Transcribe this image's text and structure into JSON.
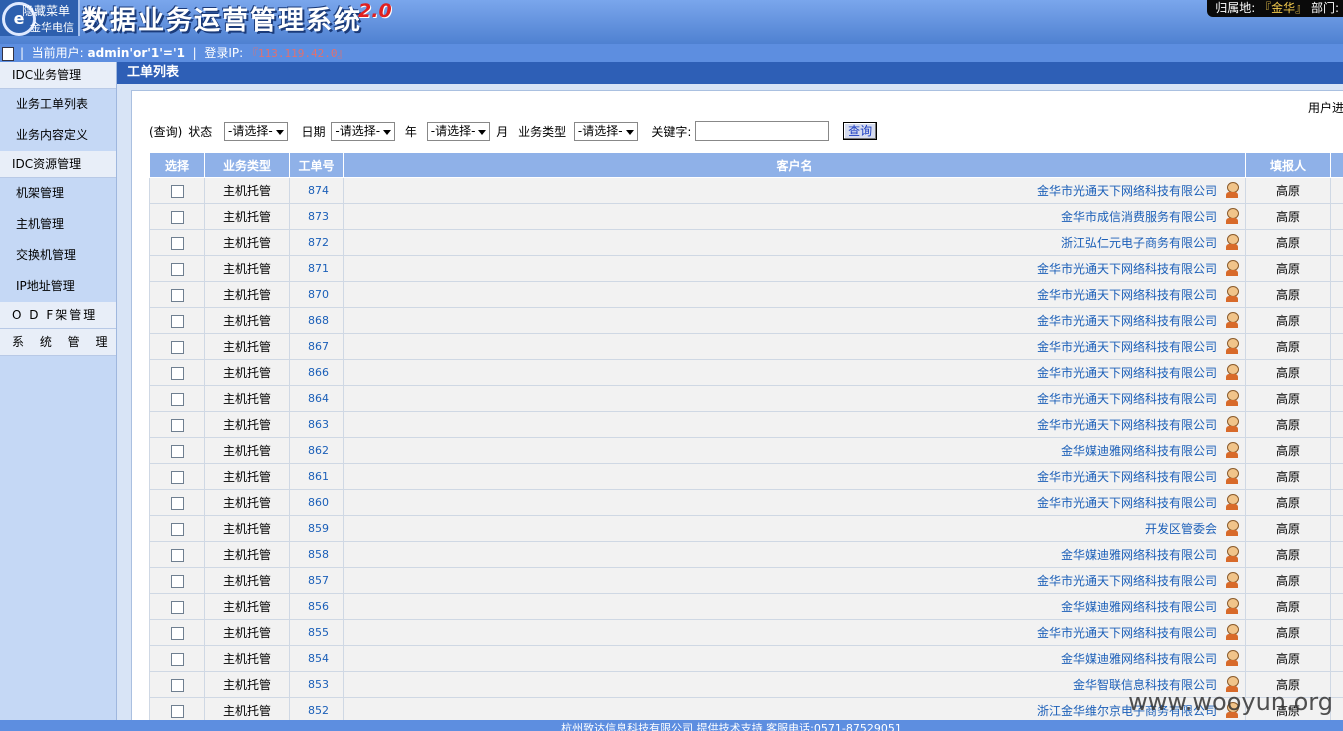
{
  "header": {
    "logo_line1": "隐藏菜单",
    "logo_line2": "金华电信",
    "logo_mark": "e",
    "app_title": "数据业务运营管理系统",
    "app_version": "2.0",
    "location_label": "归属地:",
    "location_value": "『金华』",
    "dept_label": "部门:"
  },
  "userbar": {
    "user_label": "当前用户:",
    "user_value": "admin'or'1'='1",
    "login_ip_label": "登录IP:",
    "login_ip_value": "『113.119.42.0』"
  },
  "sidebar": {
    "groups": [
      {
        "label": "IDC业务管理",
        "items": [
          "业务工单列表",
          "业务内容定义"
        ]
      },
      {
        "label": "IDC资源管理",
        "items": [
          "机架管理",
          "主机管理",
          "交换机管理",
          "IP地址管理"
        ]
      },
      {
        "label": "O D F架管理",
        "items": []
      },
      {
        "label": "系 统 管 理",
        "items": []
      }
    ]
  },
  "content": {
    "title": "工单列表",
    "user_progress": "用户进"
  },
  "search": {
    "query_label": "(查询)",
    "status_label": "状态",
    "status_select": "-请选择-",
    "date_label": "日期",
    "date_select": "-请选择-",
    "year_label": "年",
    "month_select": "-请选择-",
    "month_label": "月",
    "biztype_label": "业务类型",
    "biztype_select": "-请选择-",
    "keyword_label": "关键字:",
    "keyword_value": "",
    "query_button": "查询"
  },
  "table": {
    "columns": [
      "选择",
      "业务类型",
      "工单号",
      "客户名",
      "填报人"
    ],
    "rows": [
      {
        "type": "主机托管",
        "no": "874",
        "customer": "金华市光通天下网络科技有限公司",
        "reporter": "高原"
      },
      {
        "type": "主机托管",
        "no": "873",
        "customer": "金华市成信消费服务有限公司",
        "reporter": "高原"
      },
      {
        "type": "主机托管",
        "no": "872",
        "customer": "浙江弘仁元电子商务有限公司",
        "reporter": "高原"
      },
      {
        "type": "主机托管",
        "no": "871",
        "customer": "金华市光通天下网络科技有限公司",
        "reporter": "高原"
      },
      {
        "type": "主机托管",
        "no": "870",
        "customer": "金华市光通天下网络科技有限公司",
        "reporter": "高原"
      },
      {
        "type": "主机托管",
        "no": "868",
        "customer": "金华市光通天下网络科技有限公司",
        "reporter": "高原"
      },
      {
        "type": "主机托管",
        "no": "867",
        "customer": "金华市光通天下网络科技有限公司",
        "reporter": "高原"
      },
      {
        "type": "主机托管",
        "no": "866",
        "customer": "金华市光通天下网络科技有限公司",
        "reporter": "高原"
      },
      {
        "type": "主机托管",
        "no": "864",
        "customer": "金华市光通天下网络科技有限公司",
        "reporter": "高原"
      },
      {
        "type": "主机托管",
        "no": "863",
        "customer": "金华市光通天下网络科技有限公司",
        "reporter": "高原"
      },
      {
        "type": "主机托管",
        "no": "862",
        "customer": "金华媒迪雅网络科技有限公司",
        "reporter": "高原"
      },
      {
        "type": "主机托管",
        "no": "861",
        "customer": "金华市光通天下网络科技有限公司",
        "reporter": "高原"
      },
      {
        "type": "主机托管",
        "no": "860",
        "customer": "金华市光通天下网络科技有限公司",
        "reporter": "高原"
      },
      {
        "type": "主机托管",
        "no": "859",
        "customer": "开发区管委会",
        "reporter": "高原"
      },
      {
        "type": "主机托管",
        "no": "858",
        "customer": "金华媒迪雅网络科技有限公司",
        "reporter": "高原"
      },
      {
        "type": "主机托管",
        "no": "857",
        "customer": "金华市光通天下网络科技有限公司",
        "reporter": "高原"
      },
      {
        "type": "主机托管",
        "no": "856",
        "customer": "金华媒迪雅网络科技有限公司",
        "reporter": "高原"
      },
      {
        "type": "主机托管",
        "no": "855",
        "customer": "金华市光通天下网络科技有限公司",
        "reporter": "高原"
      },
      {
        "type": "主机托管",
        "no": "854",
        "customer": "金华媒迪雅网络科技有限公司",
        "reporter": "高原"
      },
      {
        "type": "主机托管",
        "no": "853",
        "customer": "金华智联信息科技有限公司",
        "reporter": "高原"
      },
      {
        "type": "主机托管",
        "no": "852",
        "customer": "浙江金华维尔京电子商务有限公司",
        "reporter": "高原"
      }
    ]
  },
  "footer": {
    "text": "杭州致达信息科技有限公司  提供技术支持  客服电话:0571-87529051"
  },
  "watermark": "www.wooyun.org",
  "colors": {
    "header_bg": "#5c8edb",
    "title_bar": "#2e5fb6",
    "table_header": "#8fb1e8",
    "link": "#1b5fb8",
    "version_red": "#e02020"
  }
}
